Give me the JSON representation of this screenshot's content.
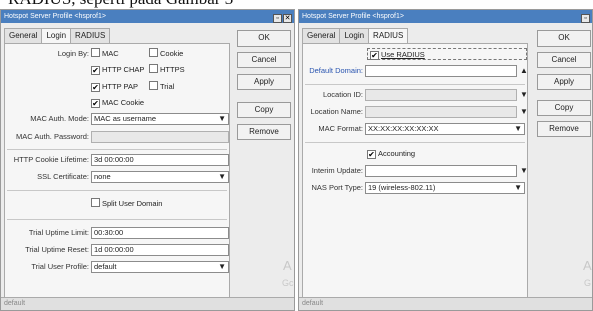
{
  "caption": "RADIUS, seperti pada Gambar 3",
  "left_window": {
    "title": "Hotspot Server Profile <hsprof1>",
    "tabs": [
      "General",
      "Login",
      "RADIUS"
    ],
    "active_tab": "Login",
    "login_by_label": "Login By:",
    "checkboxes": {
      "mac": {
        "label": "MAC",
        "checked": false
      },
      "cookie": {
        "label": "Cookie",
        "checked": false
      },
      "http_chap": {
        "label": "HTTP CHAP",
        "checked": true
      },
      "https": {
        "label": "HTTPS",
        "checked": false
      },
      "http_pap": {
        "label": "HTTP PAP",
        "checked": true
      },
      "trial": {
        "label": "Trial",
        "checked": false
      },
      "mac_cookie": {
        "label": "MAC Cookie",
        "checked": true
      }
    },
    "mac_auth_mode": {
      "label": "MAC Auth. Mode:",
      "value": "MAC as username"
    },
    "mac_auth_password": {
      "label": "MAC Auth. Password:",
      "value": ""
    },
    "http_cookie_lifetime": {
      "label": "HTTP Cookie Lifetime:",
      "value": "3d 00:00:00"
    },
    "ssl_certificate": {
      "label": "SSL Certificate:",
      "value": "none"
    },
    "split_user_domain": {
      "label": "Split User Domain",
      "checked": false
    },
    "trial_uptime_limit": {
      "label": "Trial Uptime Limit:",
      "value": "00:30:00"
    },
    "trial_uptime_reset": {
      "label": "Trial Uptime Reset:",
      "value": "1d 00:00:00"
    },
    "trial_user_profile": {
      "label": "Trial User Profile:",
      "value": "default"
    },
    "buttons": {
      "ok": "OK",
      "cancel": "Cancel",
      "apply": "Apply",
      "copy": "Copy",
      "remove": "Remove"
    },
    "ghost_text": "A",
    "ghost_text2": "Gc",
    "status": "default"
  },
  "right_window": {
    "title": "Hotspot Server Profile <hsprof1>",
    "tabs": [
      "General",
      "Login",
      "RADIUS"
    ],
    "active_tab": "RADIUS",
    "use_radius": {
      "label": "Use RADIUS",
      "checked": true
    },
    "default_domain": {
      "label": "Default Domain:",
      "value": ""
    },
    "location_id": {
      "label": "Location ID:",
      "value": ""
    },
    "location_name": {
      "label": "Location Name:",
      "value": ""
    },
    "mac_format": {
      "label": "MAC Format:",
      "value": "XX:XX:XX:XX:XX:XX"
    },
    "accounting": {
      "label": "Accounting",
      "checked": true
    },
    "interim_update": {
      "label": "Interim Update:",
      "value": ""
    },
    "nas_port_type": {
      "label": "NAS Port Type:",
      "value": "19 (wireless-802.11)"
    },
    "buttons": {
      "ok": "OK",
      "cancel": "Cancel",
      "apply": "Apply",
      "copy": "Copy",
      "remove": "Remove"
    },
    "ghost_text": "A",
    "ghost_text2": "G",
    "status": "default"
  },
  "icons": {
    "check": "✔",
    "dropdown": "▼",
    "up_arrow": "▲",
    "close": "✕"
  }
}
